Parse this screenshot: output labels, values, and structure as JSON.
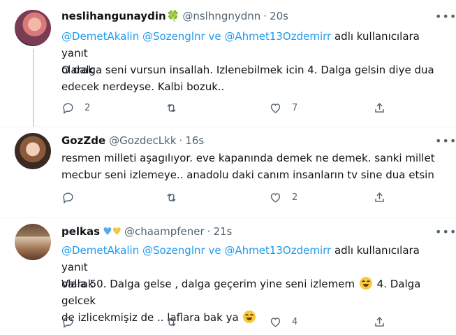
{
  "tweets": [
    {
      "name": "neslihangunaydin",
      "name_emoji": "🍀",
      "handle": "@nslhngnydnn",
      "dot": "·",
      "time": "20s",
      "reply_to": {
        "mention1": "@DemetAkalin",
        "mention2": "@Sozenglnr",
        "conj": "ve",
        "mention3": "@Ahmet13Ozdemirr",
        "suffix_line1": "adlı kullanıcılara yanıt",
        "suffix_line2": "olarak"
      },
      "text_line1": "O dalga seni vursun insallah. Izlenebilmek icin 4. Dalga gelsin diye dua",
      "text_line2": "edecek nerdeyse. Kalbi bozuk..",
      "replies": "2",
      "retweets": "",
      "likes": "7",
      "icon_names": [
        "reply-icon",
        "retweet-icon",
        "like-icon",
        "share-icon",
        "more-icon"
      ]
    },
    {
      "name": "GozZde",
      "handle": "@GozdecLkk",
      "dot": "·",
      "time": "16s",
      "text_line1": "resmen milleti aşagılıyor. eve kapanında demek ne demek. sanki millet",
      "text_line2": "mecbur seni izlemeye.. anadolu daki canım insanların tv sine dua etsin",
      "replies": "",
      "retweets": "",
      "likes": "2"
    },
    {
      "name": "pelkas",
      "name_emoji": "💙💛",
      "handle": "@chaampfener",
      "dot": "·",
      "time": "21s",
      "reply_to": {
        "mention1": "@DemetAkalin",
        "mention2": "@Sozenglnr",
        "conj": "ve",
        "mention3": "@Ahmet13Ozdemirr",
        "suffix_line1": "adlı kullanıcılara yanıt",
        "suffix_line2": "olarak"
      },
      "text_line1a": "Valla 50. Dalga gelse , dalga geçerim yine seni izlemem",
      "text_line1b": "4. Dalga gelcek",
      "text_line2": "de izlicekmişiz de .. laflara bak ya",
      "replies": "",
      "retweets": "",
      "likes": "4"
    }
  ],
  "colors": {
    "mention": "#1d9bf0",
    "secondary_text": "#536471",
    "divider": "#eff3f4"
  }
}
